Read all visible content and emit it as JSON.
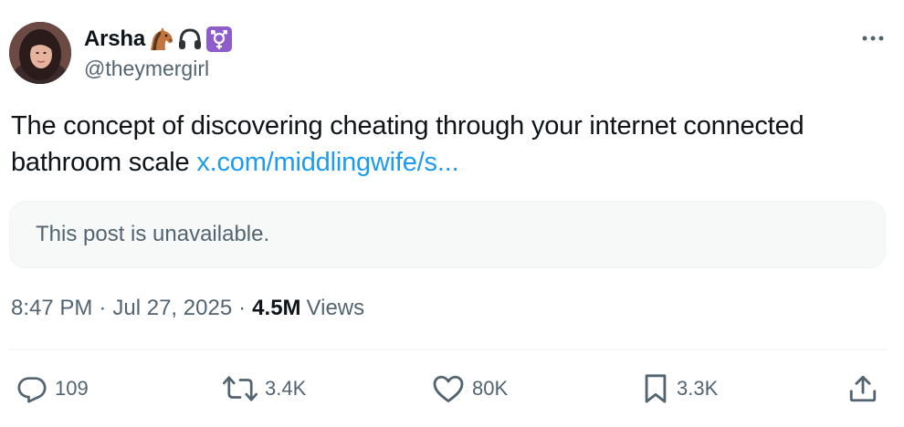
{
  "author": {
    "display_name": "Arsha",
    "handle": "@theymergirl",
    "badge_icons": [
      "horse-emoji-icon",
      "headphones-emoji-icon",
      "transgender-symbol-icon"
    ]
  },
  "post": {
    "text": "The concept of discovering cheating through your internet connected bathroom scale",
    "link_text": "x.com/middlingwife/s..."
  },
  "quoted": {
    "message": "This post is unavailable."
  },
  "meta": {
    "time": "8:47 PM",
    "separator": "·",
    "date": "Jul 27, 2025",
    "views_count": "4.5M",
    "views_label": "Views"
  },
  "actions": {
    "replies": "109",
    "reposts": "3.4K",
    "likes": "80K",
    "bookmarks": "3.3K"
  },
  "colors": {
    "link": "#1d9bf0",
    "secondary_text": "#536471",
    "primary_text": "#0f1419",
    "card_bg": "#f7f9f9",
    "trans_badge": "#8e5ccb"
  }
}
